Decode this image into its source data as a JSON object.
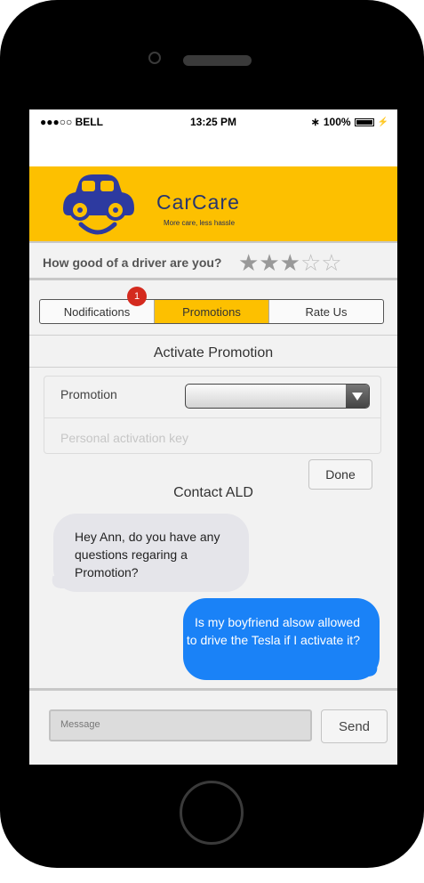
{
  "status_bar": {
    "carrier": "●●●○○ BELL",
    "time": "13:25 PM",
    "battery": "100%"
  },
  "header": {
    "brand": "CarCare",
    "tagline": "More care, less hassle",
    "accent_color": "#fdc000",
    "brand_color": "#27356f"
  },
  "rating": {
    "question": "How good of a driver are you?",
    "filled_stars": 3,
    "max_stars": 5,
    "star_full": "★",
    "star_empty": "☆"
  },
  "tabs": [
    {
      "label": "Nodifications",
      "active": false
    },
    {
      "label": "Promotions",
      "active": true
    },
    {
      "label": "Rate Us",
      "active": false
    }
  ],
  "notification_badge": "1",
  "promotion": {
    "title": "Activate Promotion",
    "field_label": "Promotion",
    "select_value": "",
    "key_placeholder": "Personal activation key",
    "done_label": "Done"
  },
  "contact": {
    "title": "Contact ALD",
    "messages": [
      {
        "direction": "incoming",
        "text": "Hey Ann, do you have any questions regaring a Promotion?"
      },
      {
        "direction": "outgoing",
        "text": "Is my boyfriend alsow allowed to drive the Tesla if I activate it?"
      }
    ],
    "incoming_color": "#e5e5ea",
    "outgoing_color": "#1a82f7",
    "message_placeholder": "Message",
    "send_label": "Send"
  }
}
